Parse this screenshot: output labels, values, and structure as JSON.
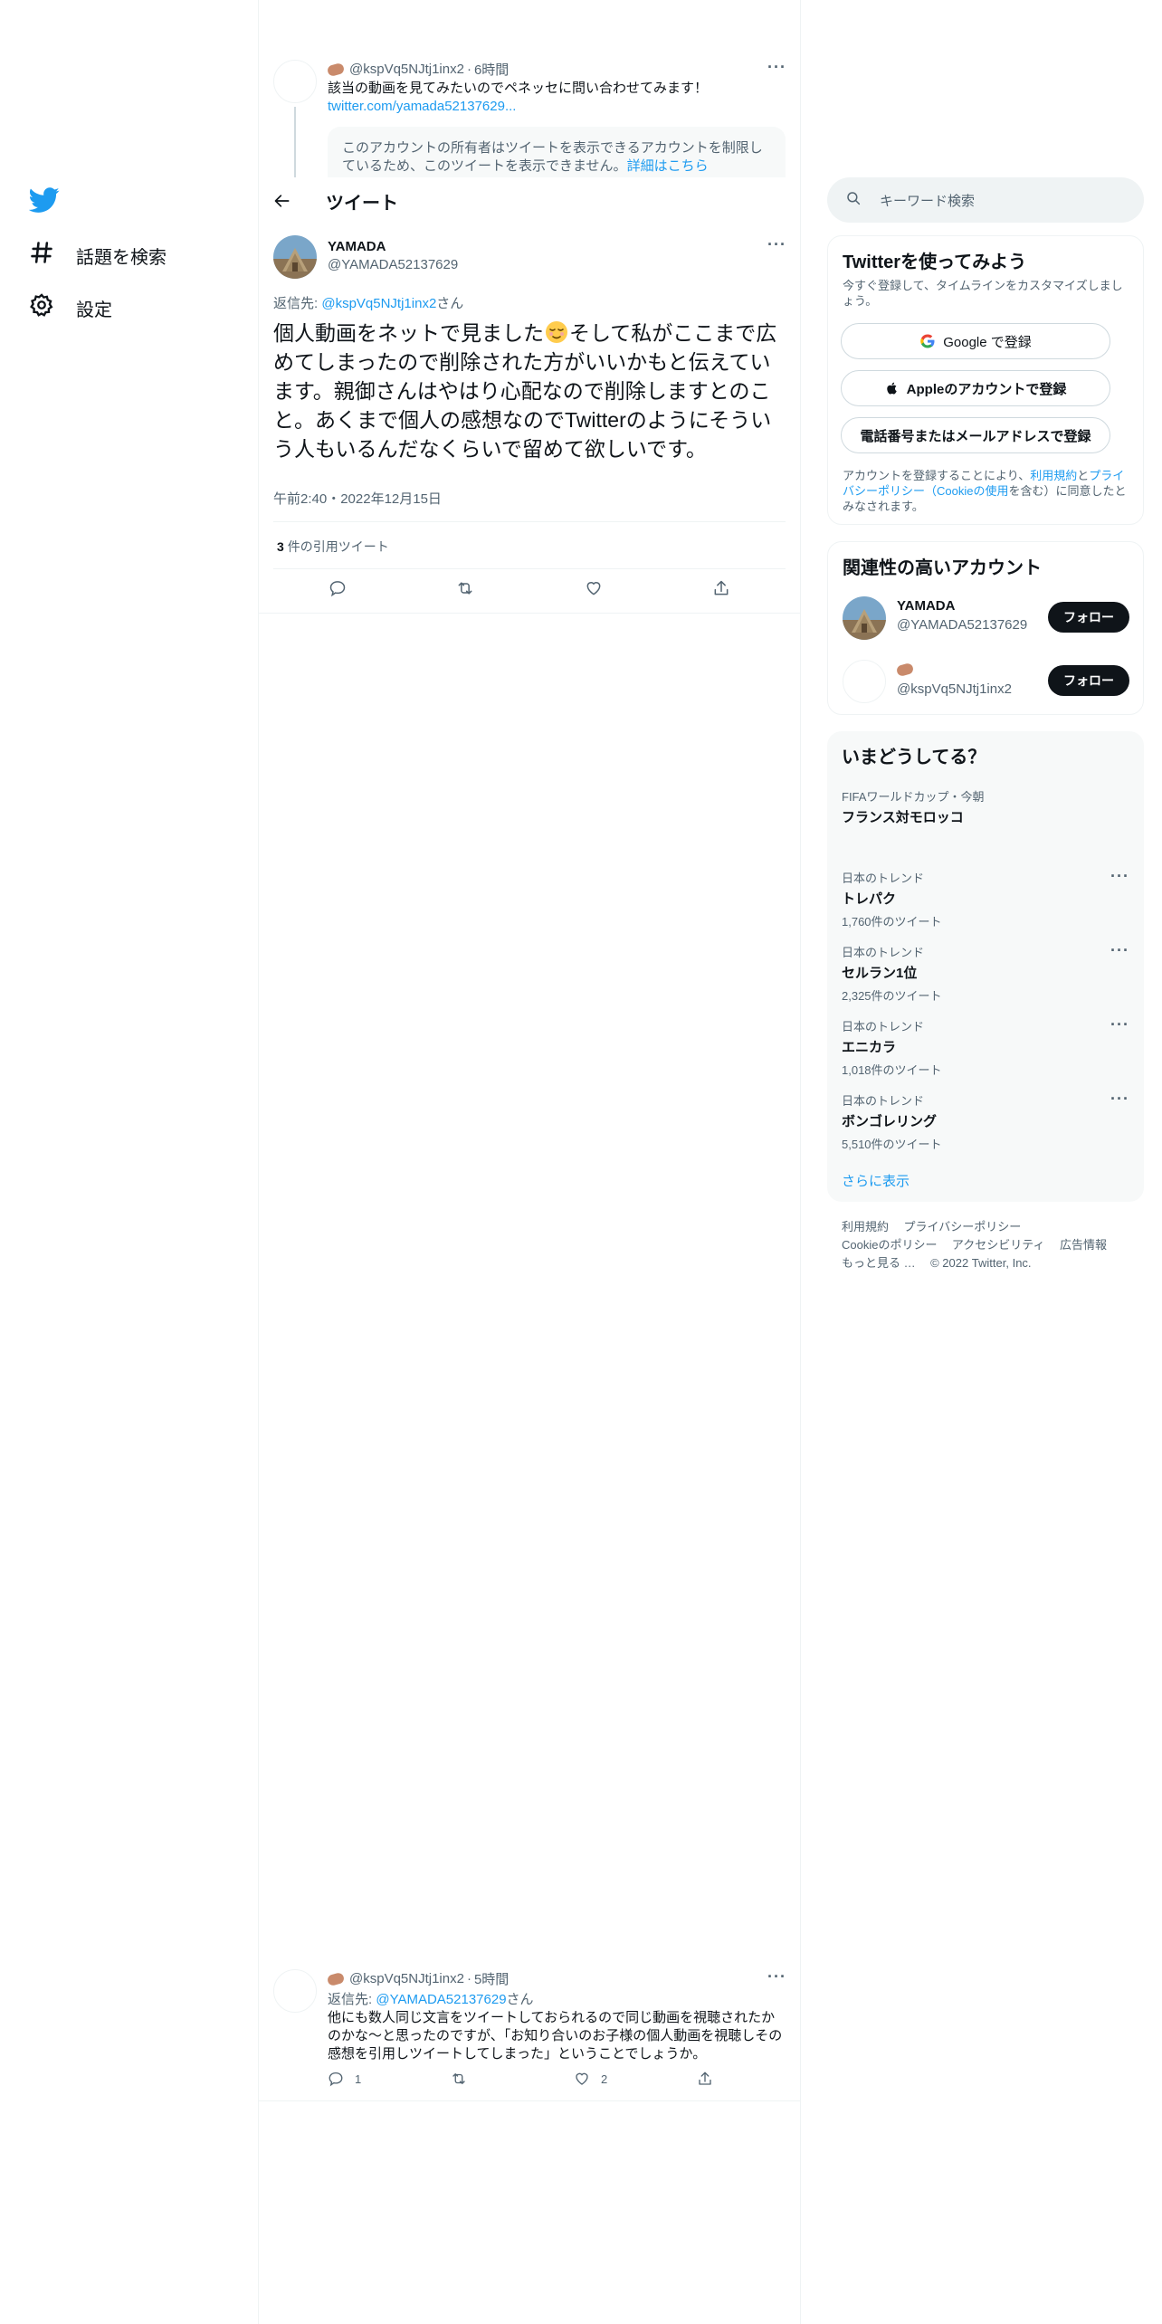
{
  "nav": {
    "logo": "twitter-bird-icon",
    "items": [
      {
        "label": "話題を検索",
        "icon": "hashtag-icon"
      },
      {
        "label": "設定",
        "icon": "gear-icon"
      }
    ]
  },
  "header": {
    "title": "ツイート",
    "back_icon": "arrow-left-icon"
  },
  "parent_tweet": {
    "handle": "@kspVq5NJtj1inx2",
    "time": "6時間",
    "text": "該当の動画を見てみたいのでペネッセに問い合わせてみます！",
    "link": "twitter.com/yamada52137629...",
    "quote_notice": "このアカウントの所有者はツイートを表示できるアカウントを制限しているため、このツイートを表示できません。",
    "quote_link": "詳細はこちら"
  },
  "main_tweet": {
    "name": "YAMADA",
    "handle": "@YAMADA52137629",
    "reply_prefix": "返信先: ",
    "reply_to": "@kspVq5NJtj1inx2",
    "reply_suffix": "さん",
    "text_before_emoji": "個人動画をネットで見ました",
    "text_after_emoji": "そして私がここまで広めてしまったので削除された方がいいかもと伝えています。親御さんはやはり心配なので削除しますとのこと。あくまで個人の感想なのでTwitterのようにそういう人もいるんだなくらいで留めて欲しいです。",
    "timestamp": "午前2:40・2022年12月15日",
    "quote_count": "3",
    "quote_label": "件の引用ツイート"
  },
  "reply_tweet": {
    "handle": "@kspVq5NJtj1inx2",
    "time": "5時間",
    "reply_prefix": "返信先: ",
    "reply_to": "@YAMADA52137629",
    "reply_suffix": "さん",
    "text": "他にも数人同じ文言をツイートしておられるので同じ動画を視聴されたかのかな〜と思ったのですが、「お知り合いのお子様の個人動画を視聴しその感想を引用しツイートしてしまった」ということでしょうか。",
    "reply_count": "1",
    "like_count": "2"
  },
  "search": {
    "placeholder": "キーワード検索"
  },
  "signup": {
    "title": "Twitterを使ってみよう",
    "subtitle": "今すぐ登録して、タイムラインをカスタマイズしましょう。",
    "google_btn": "Google で登録",
    "apple_btn": "Appleのアカウントで登録",
    "phone_btn": "電話番号またはメールアドレスで登録",
    "legal_1": "アカウントを登録することにより、",
    "legal_terms": "利用規約",
    "legal_and": "と",
    "legal_privacy": "プライバシーポリシー",
    "legal_paren_open": "（",
    "legal_cookie": "Cookieの使用",
    "legal_2": "を含む）に同意したとみなされます。"
  },
  "related": {
    "title": "関連性の高いアカウント",
    "accounts": [
      {
        "name": "YAMADA",
        "handle": "@YAMADA52137629",
        "follow": "フォロー"
      },
      {
        "name": "",
        "handle": "@kspVq5NJtj1inx2",
        "follow": "フォロー"
      }
    ]
  },
  "trends": {
    "title": "いまどうしてる？",
    "event": {
      "context": "FIFAワールドカップ・今朝",
      "name": "フランス対モロッコ"
    },
    "items": [
      {
        "context": "日本のトレンド",
        "name": "トレパク",
        "count": "1,760件のツイート"
      },
      {
        "context": "日本のトレンド",
        "name": "セルラン1位",
        "count": "2,325件のツイート"
      },
      {
        "context": "日本のトレンド",
        "name": "エニカラ",
        "count": "1,018件のツイート"
      },
      {
        "context": "日本のトレンド",
        "name": "ボンゴレリング",
        "count": "5,510件のツイート"
      }
    ],
    "show_more": "さらに表示"
  },
  "footer": {
    "links": [
      "利用規約",
      "プライバシーポリシー",
      "Cookieのポリシー",
      "アクセシビリティ",
      "広告情報",
      "もっと見る …"
    ],
    "copyright": "© 2022 Twitter, Inc."
  },
  "colors": {
    "accent": "#1d9bf0",
    "text": "#0f1419",
    "muted": "#536471",
    "border": "#eff3f4"
  }
}
